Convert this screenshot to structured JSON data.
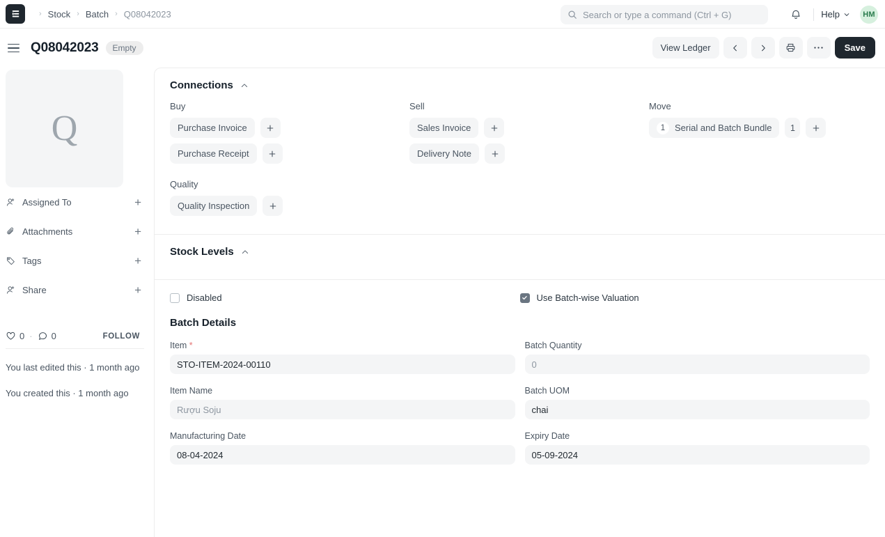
{
  "navbar": {
    "logo_icon": "erpnext-logo-icon",
    "breadcrumb": [
      {
        "label": "Stock",
        "last": false
      },
      {
        "label": "Batch",
        "last": false
      },
      {
        "label": "Q08042023",
        "last": true
      }
    ],
    "search": {
      "placeholder": "Search or type a command (Ctrl + G)",
      "value": "",
      "icon": "search-icon"
    },
    "notifications_icon": "bell-icon",
    "help_label": "Help",
    "help_chevron_icon": "chevron-down-icon",
    "avatar_initials": "HM",
    "avatar_bg": "#d6f0de",
    "avatar_fg": "#2a7c4d"
  },
  "page_header": {
    "menu_icon": "hamburger-menu-icon",
    "title": "Q08042023",
    "status_badge": "Empty",
    "view_ledger_label": "View Ledger",
    "prev_icon": "chevron-left-icon",
    "next_icon": "chevron-right-icon",
    "print_icon": "printer-icon",
    "more_icon": "ellipsis-icon",
    "save_label": "Save"
  },
  "sidebar": {
    "thumbnail_letter": "Q",
    "items": [
      {
        "label": "Assigned To",
        "icon": "user-plus-icon",
        "action": "+"
      },
      {
        "label": "Attachments",
        "icon": "paperclip-icon",
        "action": "+"
      },
      {
        "label": "Tags",
        "icon": "tag-icon",
        "action": "+"
      },
      {
        "label": "Share",
        "icon": "user-share-icon",
        "action": "+"
      }
    ],
    "likes_icon": "heart-icon",
    "likes_count": "0",
    "separator": "·",
    "comments_icon": "comment-icon",
    "comments_count": "0",
    "follow_label": "FOLLOW",
    "notes": [
      "You last edited this · 1 month ago",
      "You created this · 1 month ago"
    ]
  },
  "connections": {
    "title": "Connections",
    "collapse_icon": "chevron-up-icon",
    "groups": [
      {
        "label": "Buy",
        "links": [
          {
            "label": "Purchase Invoice",
            "count": null,
            "add_icon": "plus-icon"
          },
          {
            "label": "Purchase Receipt",
            "count": null,
            "add_icon": "plus-icon"
          }
        ]
      },
      {
        "label": "Sell",
        "links": [
          {
            "label": "Sales Invoice",
            "count": null,
            "add_icon": "plus-icon"
          },
          {
            "label": "Delivery Note",
            "count": null,
            "add_icon": "plus-icon"
          }
        ]
      },
      {
        "label": "Move",
        "links": [
          {
            "label": "Serial and Batch Bundle",
            "count": "1",
            "badge": "1",
            "add_icon": "plus-icon"
          }
        ]
      }
    ],
    "quality": {
      "label": "Quality",
      "links": [
        {
          "label": "Quality Inspection",
          "count": null,
          "add_icon": "plus-icon"
        }
      ]
    }
  },
  "stock_levels": {
    "title": "Stock Levels",
    "collapse_icon": "chevron-up-icon"
  },
  "checkboxes": [
    {
      "label": "Disabled",
      "checked": false
    },
    {
      "label": "Use Batch-wise Valuation",
      "checked": true
    }
  ],
  "batch_details": {
    "title": "Batch Details",
    "fields_left": [
      {
        "label": "Item",
        "required": true,
        "value": "STO-ITEM-2024-00110",
        "readonly": false
      },
      {
        "label": "Item Name",
        "required": false,
        "value": "Rượu Soju",
        "readonly": true
      },
      {
        "label": "Manufacturing Date",
        "required": false,
        "value": "08-04-2024",
        "readonly": false
      }
    ],
    "fields_right": [
      {
        "label": "Batch Quantity",
        "required": false,
        "value": "0",
        "readonly": true
      },
      {
        "label": "Batch UOM",
        "required": false,
        "value": "chai",
        "readonly": false
      },
      {
        "label": "Expiry Date",
        "required": false,
        "value": "05-09-2024",
        "readonly": false
      }
    ]
  }
}
